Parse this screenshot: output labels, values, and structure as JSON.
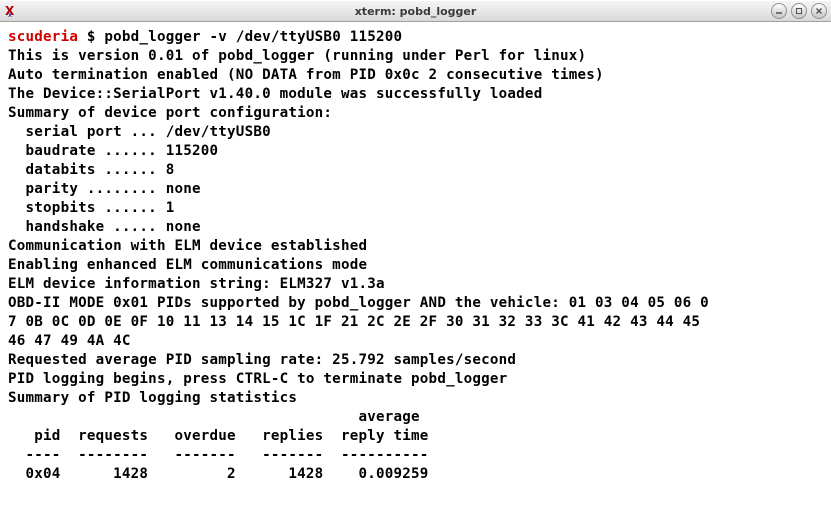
{
  "window": {
    "title": "xterm: pobd_logger"
  },
  "prompt": {
    "host": "scuderia",
    "symbol": "$",
    "command": "pobd_logger -v /dev/ttyUSB0 115200"
  },
  "output": {
    "line1": "This is version 0.01 of pobd_logger (running under Perl for linux)",
    "line2": "Auto termination enabled (NO DATA from PID 0x0c 2 consecutive times)",
    "line3": "The Device::SerialPort v1.40.0 module was successfully loaded",
    "line4": "Summary of device port configuration:",
    "line5": "  serial port ... /dev/ttyUSB0",
    "line6": "  baudrate ...... 115200",
    "line7": "  databits ...... 8",
    "line8": "  parity ........ none",
    "line9": "  stopbits ...... 1",
    "line10": "  handshake ..... none",
    "line11": "Communication with ELM device established",
    "line12": "Enabling enhanced ELM communications mode",
    "line13": "ELM device information string: ELM327 v1.3a",
    "line14": "OBD-II MODE 0x01 PIDs supported by pobd_logger AND the vehicle: 01 03 04 05 06 0",
    "line15": "7 0B 0C 0D 0E 0F 10 11 13 14 15 1C 1F 21 2C 2E 2F 30 31 32 33 3C 41 42 43 44 45",
    "line16": "46 47 49 4A 4C",
    "line17": "Requested average PID sampling rate: 25.792 samples/second",
    "line18": "PID logging begins, press CTRL-C to terminate pobd_logger",
    "line19": "Summary of PID logging statistics",
    "line20": "                                        average",
    "line21": "   pid  requests   overdue   replies  reply time",
    "line22": "  ----  --------   -------   -------  ----------",
    "line23": "  0x04      1428         2      1428    0.009259"
  },
  "stats": {
    "pid": "0x04",
    "requests": 1428,
    "overdue": 2,
    "replies": 1428,
    "avg_reply_time": 0.009259
  },
  "config": {
    "serial_port": "/dev/ttyUSB0",
    "baudrate": 115200,
    "databits": 8,
    "parity": "none",
    "stopbits": 1,
    "handshake": "none"
  }
}
